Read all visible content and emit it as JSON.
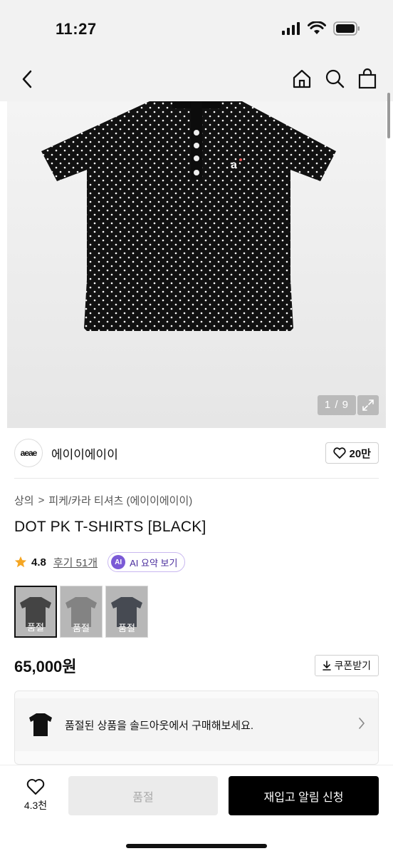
{
  "status": {
    "time": "11:27"
  },
  "gallery": {
    "counter": "1 / 9"
  },
  "brand": {
    "logo_text": "aeae",
    "name": "에이이에이이",
    "likes": "20만"
  },
  "breadcrumb": {
    "category": "상의",
    "separator": ">",
    "subcategory": "피케/카라 티셔츠 (에이이에이이)"
  },
  "product": {
    "title": "DOT PK T-SHIRTS [BLACK]",
    "rating": "4.8",
    "reviews_label": "후기 51개",
    "ai_badge": "AI",
    "ai_summary_label": "AI 요약 보기",
    "price": "65,000원",
    "coupon_label": "쿠폰받기"
  },
  "colors": {
    "shirt_black": "#1a1a1a",
    "shirt_gray": "#8d8d8d",
    "shirt_navy": "#1e2533",
    "accent_ai": "#7b5ad6",
    "star": "#f5a623"
  },
  "options": [
    {
      "label": "품절",
      "color": "black"
    },
    {
      "label": "품절",
      "color": "gray"
    },
    {
      "label": "품절",
      "color": "navy"
    }
  ],
  "promo": {
    "text": "품절된 상품을 솔드아웃에서 구매해보세요."
  },
  "bottom": {
    "like_count": "4.3천",
    "soldout_label": "품절",
    "restock_label": "재입고 알림 신청"
  },
  "icons": [
    "back-icon",
    "home-icon",
    "search-icon",
    "bag-icon",
    "expand-icon",
    "heart-icon",
    "star-icon",
    "download-icon",
    "chevron-right-icon"
  ]
}
